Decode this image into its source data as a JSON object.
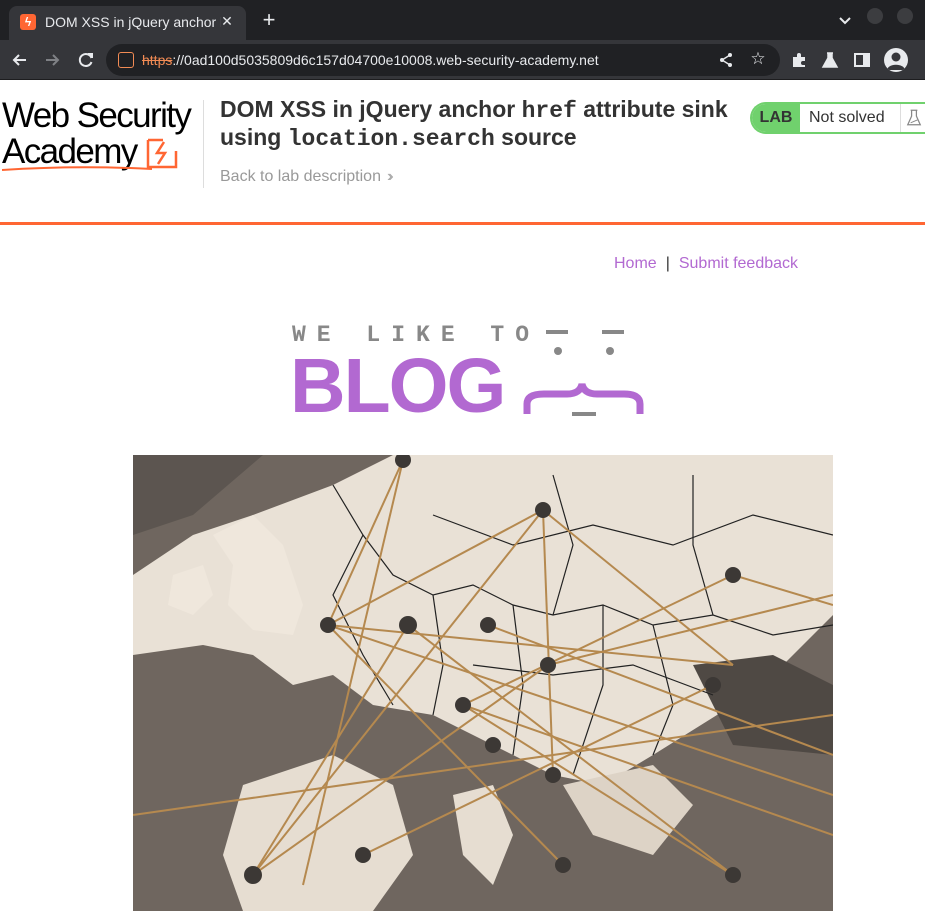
{
  "browser": {
    "tab_title": "DOM XSS in jQuery anchor href attribute sink using location.search source",
    "url_scheme": "https",
    "url_rest": "://0ad100d5035809d6c157d04700e10008.web-security-academy.net",
    "accent": "#f28b54"
  },
  "academy": {
    "logo_line1": "Web Security",
    "logo_line2": "Academy",
    "title_part1": "DOM XSS in jQuery anchor ",
    "title_code1": "href",
    "title_part2": " attribute sink using ",
    "title_code2": "location.search",
    "title_part3": " source",
    "back_link": "Back to lab description",
    "lab_label": "LAB",
    "status": "Not solved",
    "brand_color": "#ff6633",
    "badge_color": "#70d16d"
  },
  "blog": {
    "nav_home": "Home",
    "nav_separator": "|",
    "nav_feedback": "Submit feedback",
    "logo_top": "WE LIKE TO",
    "logo_word": "BLOG",
    "link_color": "#b269d1"
  }
}
